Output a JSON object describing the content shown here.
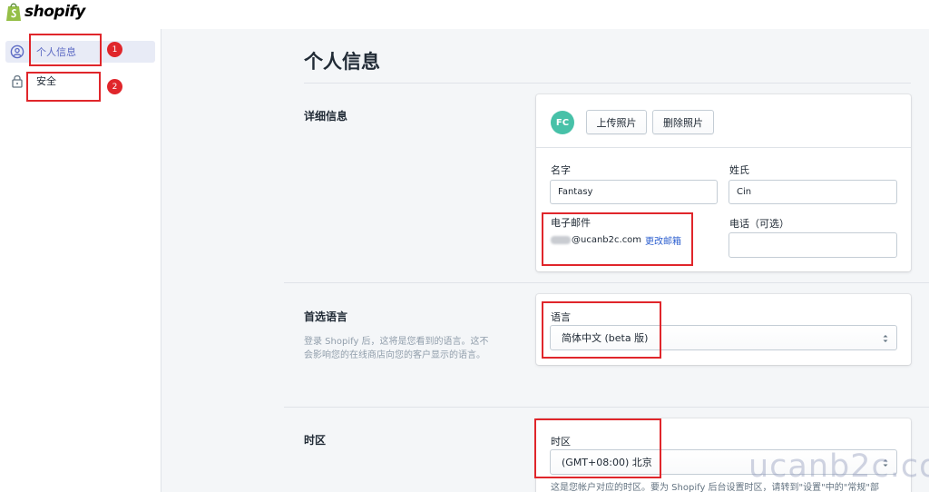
{
  "brand": {
    "logo_text": "shopify"
  },
  "sidebar": {
    "items": [
      {
        "label": "个人信息",
        "icon": "user-circle-icon",
        "active": true,
        "badge": "1"
      },
      {
        "label": "安全",
        "icon": "lock-icon",
        "active": false,
        "badge": "2"
      }
    ]
  },
  "main": {
    "title": "个人信息",
    "details": {
      "heading": "详细信息",
      "avatar_initials": "FC",
      "upload_photo": "上传照片",
      "delete_photo": "删除照片",
      "first_name_label": "名字",
      "first_name_value": "Fantasy",
      "last_name_label": "姓氏",
      "last_name_value": "Cin",
      "email_label": "电子邮件",
      "email_value": "@ucanb2c.com",
      "change_email": "更改邮箱",
      "phone_label": "电话（可选）",
      "phone_value": ""
    },
    "language": {
      "heading": "首选语言",
      "description": "登录 Shopify 后，这将是您看到的语言。这不会影响您的在线商店向您的客户显示的语言。",
      "label": "语言",
      "selected": "简体中文 (beta 版)"
    },
    "timezone": {
      "heading": "时区",
      "label": "时区",
      "selected": "(GMT+08:00) 北京",
      "help": "这是您帐户对应的时区。要为 Shopify 后台设置时区，请转到\"设置\"中的\"常规\"部"
    }
  },
  "watermark": "ucanb2c.com",
  "colors": {
    "accent": "#5c6ac4",
    "highlight": "#e0262b",
    "avatar": "#47c1a8",
    "link": "#2b5ecf"
  }
}
